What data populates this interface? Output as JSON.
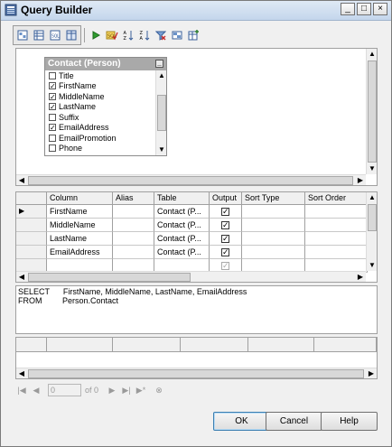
{
  "window": {
    "title": "Query Builder",
    "controls": [
      "_",
      "□",
      "×"
    ]
  },
  "toolbar": {
    "buttons": [
      {
        "name": "diagram-pane-icon"
      },
      {
        "name": "criteria-pane-icon"
      },
      {
        "name": "sql-pane-icon"
      },
      {
        "name": "results-pane-icon"
      },
      {
        "name": "execute-icon"
      },
      {
        "name": "verify-sql-icon"
      },
      {
        "name": "sort-ascending-icon"
      },
      {
        "name": "sort-descending-icon"
      },
      {
        "name": "remove-filter-icon"
      },
      {
        "name": "group-by-icon"
      },
      {
        "name": "add-table-icon"
      }
    ]
  },
  "diagram": {
    "table_title": "Contact (Person)",
    "columns": [
      {
        "label": "Title",
        "checked": false
      },
      {
        "label": "FirstName",
        "checked": true
      },
      {
        "label": "MiddleName",
        "checked": true
      },
      {
        "label": "LastName",
        "checked": true
      },
      {
        "label": "Suffix",
        "checked": false
      },
      {
        "label": "EmailAddress",
        "checked": true
      },
      {
        "label": "EmailPromotion",
        "checked": false
      },
      {
        "label": "Phone",
        "checked": false
      }
    ]
  },
  "grid": {
    "headers": [
      "Column",
      "Alias",
      "Table",
      "Output",
      "Sort Type",
      "Sort Order"
    ],
    "rows": [
      {
        "column": "FirstName",
        "alias": "",
        "table": "Contact (P...",
        "output": true,
        "current": true
      },
      {
        "column": "MiddleName",
        "alias": "",
        "table": "Contact (P...",
        "output": true,
        "current": false
      },
      {
        "column": "LastName",
        "alias": "",
        "table": "Contact (P...",
        "output": true,
        "current": false
      },
      {
        "column": "EmailAddress",
        "alias": "",
        "table": "Contact (P...",
        "output": true,
        "current": false
      },
      {
        "column": "",
        "alias": "",
        "table": "",
        "output": true,
        "current": false,
        "placeholder": true
      }
    ]
  },
  "sql": {
    "line1": "SELECT      FirstName, MiddleName, LastName, EmailAddress",
    "line2": "FROM         Person.Contact"
  },
  "navigation": {
    "position": "0",
    "of_label": "of 0"
  },
  "buttons": {
    "ok": "OK",
    "cancel": "Cancel",
    "help": "Help"
  }
}
